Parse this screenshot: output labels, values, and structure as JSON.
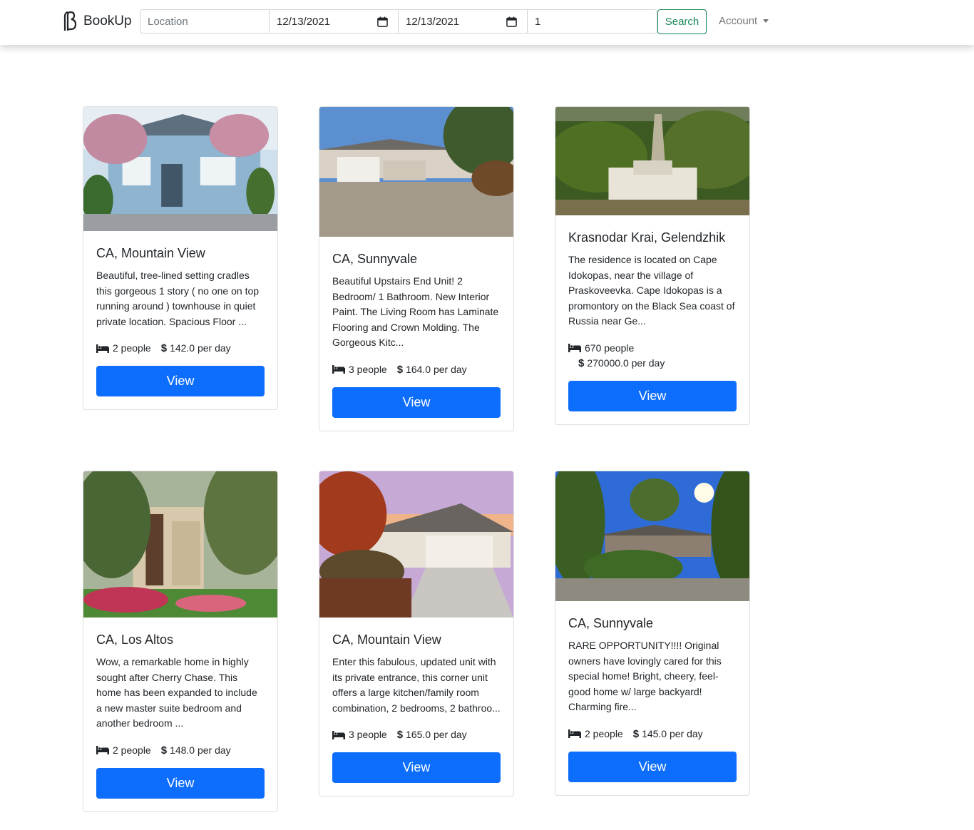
{
  "navbar": {
    "brand": "BookUp",
    "location_placeholder": "Location",
    "check_in": "12/13/2021",
    "check_out": "12/13/2021",
    "guests": "1",
    "search_label": "Search",
    "account_label": "Account"
  },
  "listings": [
    {
      "title": "CA, Mountain View",
      "description": "Beautiful, tree-lined setting cradles this gorgeous 1 story ( no one on top running around ) townhouse in quiet private location. Spacious Floor ...",
      "people": "2 people",
      "price": "142.0 per day",
      "button": "View"
    },
    {
      "title": "CA, Sunnyvale",
      "description": "Beautiful Upstairs End Unit! 2 Bedroom/ 1 Bathroom. New Interior Paint. The Living Room has Laminate Flooring and Crown Molding. The Gorgeous Kitc...",
      "people": "3 people",
      "price": "164.0 per day",
      "button": "View"
    },
    {
      "title": "Krasnodar Krai, Gelendzhik",
      "description": "The residence is located on Cape Idokopas, near the village of Praskoveevka. Cape Idokopas is a promontory on the Black Sea coast of Russia near Ge...",
      "people": "670 people",
      "price": "270000.0 per day",
      "button": "View"
    },
    {
      "title": "CA, Los Altos",
      "description": "Wow, a remarkable home in highly sought after Cherry Chase. This home has been expanded to include a new master suite bedroom and another bedroom ...",
      "people": "2 people",
      "price": "148.0 per day",
      "button": "View"
    },
    {
      "title": "CA, Mountain View",
      "description": "Enter this fabulous, updated unit with its private entrance, this corner unit offers a large kitchen/family room combination, 2 bedrooms, 2 bathroo...",
      "people": "3 people",
      "price": "165.0 per day",
      "button": "View"
    },
    {
      "title": "CA, Sunnyvale",
      "description": "RARE OPPORTUNITY!!!! Original owners have lovingly cared for this special home! Bright, cheery, feel-good home w/ large backyard! Charming fire...",
      "people": "2 people",
      "price": "145.0 per day",
      "button": "View"
    }
  ]
}
